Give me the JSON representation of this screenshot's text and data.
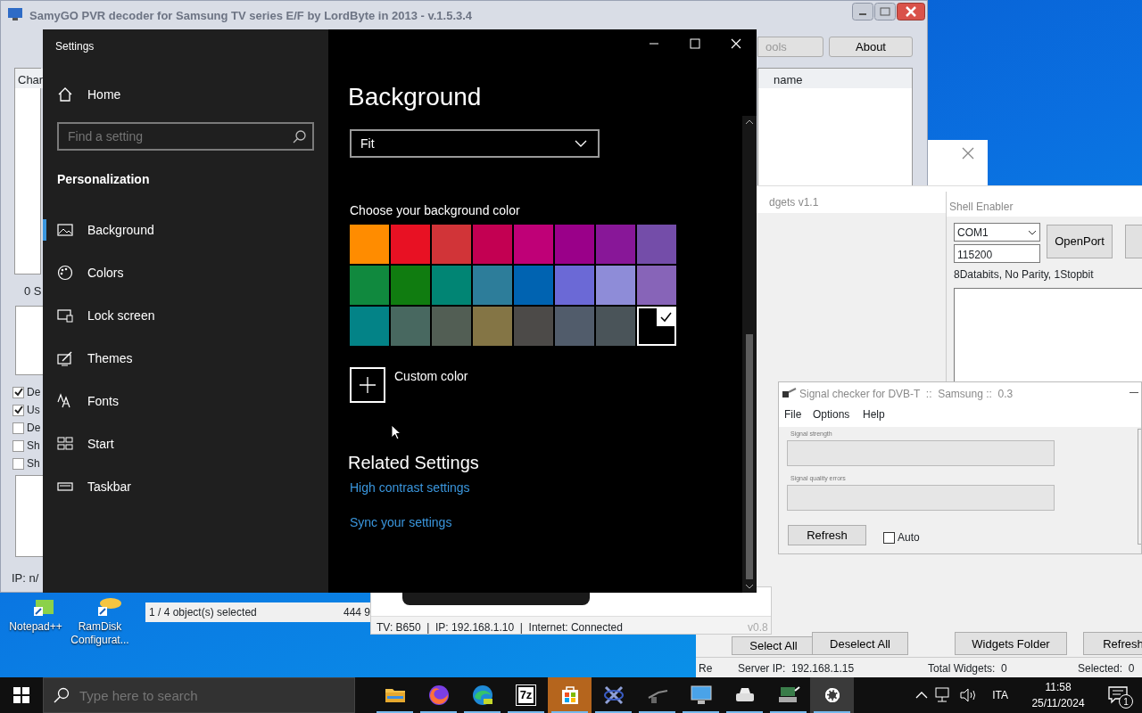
{
  "desktop": {
    "icons": [
      {
        "kind": "notepad",
        "label": "Notepad++"
      },
      {
        "kind": "ramdisk",
        "label": "RamDisk Configurat..."
      }
    ]
  },
  "samygo": {
    "title": "SamyGO PVR decoder for Samsung TV series E/F by LordByte in 2013 - v.1.5.3.4",
    "buttons": [
      "ools",
      "About"
    ],
    "columns": [
      "Char",
      "name"
    ],
    "count": "0 S",
    "checkboxes": [
      {
        "label": "De",
        "checked": true
      },
      {
        "label": "Us",
        "checked": true
      },
      {
        "label": "De",
        "checked": false
      },
      {
        "label": "Sh",
        "checked": false
      },
      {
        "label": "Sh",
        "checked": false
      }
    ],
    "status": "IP: n/"
  },
  "explorer": {
    "selection": "1 / 4 object(s) selected",
    "size": "444 9"
  },
  "widgets": {
    "title": "dgets v1.1",
    "buttons": [
      "Select All",
      "Deselect All",
      "Widgets Folder",
      "Refresh"
    ],
    "status": [
      "Re",
      "Server IP:  192.168.1.15",
      "Total Widgets:  0",
      "Selected:  0"
    ]
  },
  "shell_enabler": {
    "title": "Shell Enabler",
    "port": "COM1",
    "baud": "115200",
    "button": "OpenPort",
    "info": "8Databits, No Parity, 1Stopbit"
  },
  "signal_checker": {
    "title": "Signal checker for DVB-T  ::  Samsung ::  0.3",
    "menu": [
      "File",
      "Options",
      "Help"
    ],
    "fields": [
      "Signal strength",
      "Signal quality errors"
    ],
    "button": "Refresh",
    "auto": {
      "label": "Auto",
      "checked": false
    }
  },
  "tv_window": {
    "status": "TV: B650  |  IP: 192.168.1.10  |  Internet: Connected",
    "version": "v0.8"
  },
  "settings": {
    "title": "Settings",
    "home": "Home",
    "search": {
      "placeholder": "Find a setting"
    },
    "section": "Personalization",
    "nav": [
      {
        "kind": "background",
        "label": "Background",
        "selected": true
      },
      {
        "kind": "colors",
        "label": "Colors",
        "selected": false
      },
      {
        "kind": "lock",
        "label": "Lock screen",
        "selected": false
      },
      {
        "kind": "themes",
        "label": "Themes",
        "selected": false
      },
      {
        "kind": "fonts",
        "label": "Fonts",
        "selected": false
      },
      {
        "kind": "start",
        "label": "Start",
        "selected": false
      },
      {
        "kind": "taskbar",
        "label": "Taskbar",
        "selected": false
      }
    ],
    "heading": "Background",
    "fit_value": "Fit",
    "color_label": "Choose your background color",
    "swatches": [
      {
        "color": "#ff8c00",
        "selected": false
      },
      {
        "color": "#e81123",
        "selected": false
      },
      {
        "color": "#d13438",
        "selected": false
      },
      {
        "color": "#c30052",
        "selected": false
      },
      {
        "color": "#bf0077",
        "selected": false
      },
      {
        "color": "#9a0089",
        "selected": false
      },
      {
        "color": "#881798",
        "selected": false
      },
      {
        "color": "#744da9",
        "selected": false
      },
      {
        "color": "#10893e",
        "selected": false
      },
      {
        "color": "#107c10",
        "selected": false
      },
      {
        "color": "#018574",
        "selected": false
      },
      {
        "color": "#2d7d9a",
        "selected": false
      },
      {
        "color": "#0063b1",
        "selected": false
      },
      {
        "color": "#6b69d6",
        "selected": false
      },
      {
        "color": "#8e8cd8",
        "selected": false
      },
      {
        "color": "#8764b8",
        "selected": false
      },
      {
        "color": "#038387",
        "selected": false
      },
      {
        "color": "#486860",
        "selected": false
      },
      {
        "color": "#525e54",
        "selected": false
      },
      {
        "color": "#847545",
        "selected": false
      },
      {
        "color": "#4c4a48",
        "selected": false
      },
      {
        "color": "#515c6b",
        "selected": false
      },
      {
        "color": "#4a5459",
        "selected": false
      },
      {
        "color": "#000000",
        "selected": true
      }
    ],
    "custom_color": "Custom color",
    "related_heading": "Related Settings",
    "links": [
      "High contrast settings",
      "Sync your settings"
    ]
  },
  "taskbar": {
    "search_placeholder": "Type here to search",
    "apps": [
      {
        "kind": "folder",
        "hovered": false,
        "selected": false
      },
      {
        "kind": "firefox",
        "hovered": false,
        "selected": false
      },
      {
        "kind": "edge",
        "hovered": false,
        "selected": false
      },
      {
        "kind": "sevenzip",
        "text": "7z",
        "hovered": false,
        "selected": false
      },
      {
        "kind": "store",
        "hovered": true,
        "selected": false
      },
      {
        "kind": "tool",
        "hovered": false,
        "selected": false
      },
      {
        "kind": "antenna",
        "hovered": false,
        "selected": false
      },
      {
        "kind": "monitor",
        "hovered": false,
        "selected": false
      },
      {
        "kind": "printer",
        "hovered": false,
        "selected": false
      },
      {
        "kind": "network",
        "hovered": false,
        "selected": false
      },
      {
        "kind": "gear",
        "hovered": false,
        "selected": true
      }
    ],
    "language": "ITA",
    "time": "11:58",
    "date": "25/11/2024",
    "notifications": "1"
  }
}
